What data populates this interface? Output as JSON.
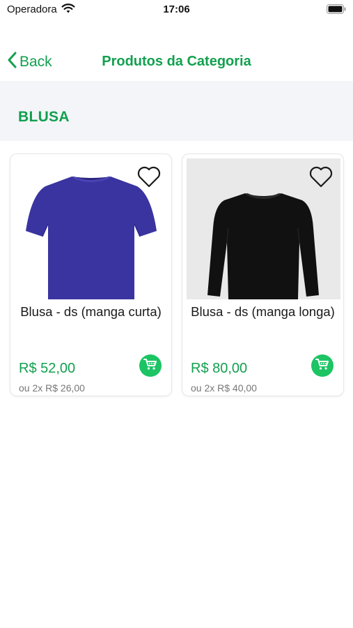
{
  "status_bar": {
    "carrier": "Operadora",
    "time": "17:06"
  },
  "nav": {
    "back_label": "Back",
    "title": "Produtos da Categoria"
  },
  "category": {
    "title": "BLUSA"
  },
  "products": [
    {
      "name": "Blusa - ds (manga curta)",
      "price": "R$ 52,00",
      "installment": "ou 2x R$ 26,00",
      "image": "blue-short-sleeve-shirt",
      "color": "#3a34a0"
    },
    {
      "name": "Blusa - ds (manga longa)",
      "price": "R$ 80,00",
      "installment": "ou 2x R$ 40,00",
      "image": "black-long-sleeve-shirt",
      "color": "#111111"
    }
  ],
  "colors": {
    "accent": "#12a04f",
    "cart_button": "#1cc463",
    "header_bg": "#f3f5f8"
  }
}
